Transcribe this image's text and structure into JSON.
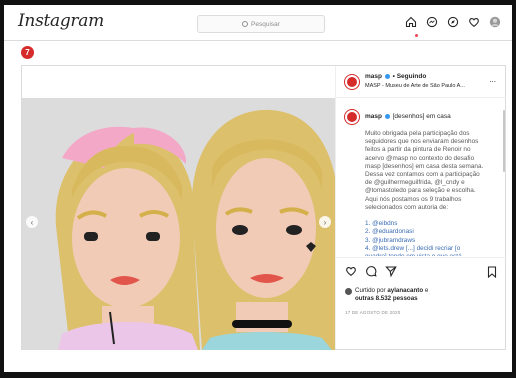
{
  "nav": {
    "logo": "Instagram",
    "search_placeholder": "Pesquisar",
    "icons": [
      "home-icon",
      "messenger-icon",
      "explore-icon",
      "heart-icon",
      "profile-avatar"
    ]
  },
  "notification_badge": "7",
  "post": {
    "account": "masp",
    "follow_status": "• Seguindo",
    "subtitle": "MASP - Museu de Arte de São Paulo A...",
    "more": "...",
    "caption_user": "masp",
    "caption_title": "[desenhos] em casa",
    "caption_lines": [
      {
        "text": "Muito obrigada pela participação dos",
        "link": false
      },
      {
        "text": "seguidores que nos enviaram desenhos",
        "link": false
      },
      {
        "text": "feitos a partir da pintura de Renoir no",
        "link": false
      },
      {
        "text": "acervo @masp no contexto do desafio",
        "link": false
      },
      {
        "text": "masp [desenhos] em casa desta semana.",
        "link": false
      },
      {
        "text": "Dessa vez contamos com a participação",
        "link": false
      },
      {
        "text": "de @guilhermeguilfrida, @l_cndy e",
        "link": false
      },
      {
        "text": "@tomastoledo para seleção e escolha.",
        "link": false
      },
      {
        "text": "Aqui nós postamos os 9 trabalhos",
        "link": false
      },
      {
        "text": "selecionados com autoria de:",
        "link": false
      },
      {
        "text": "",
        "link": false
      },
      {
        "text": "1. @eibdns",
        "link": true
      },
      {
        "text": "2. @eduardonasi",
        "link": true
      },
      {
        "text": "3. @jubramdraws",
        "link": true
      },
      {
        "text": "4. @lets.drew [...] decidi recriar [o",
        "link": true
      },
      {
        "text": "quadro] tendo em vista o que está",
        "link": true
      }
    ],
    "liked_by_prefix": "Curtido por ",
    "liked_by_user": "aylanacanto",
    "liked_by_suffix": " e",
    "liked_by_others": "outras 8.532 pessoas",
    "date": "17 DE AGOSTO DE 2020"
  },
  "colors": {
    "brand_red": "#d52b2b",
    "verified_blue": "#3897f0",
    "link_blue": "#3b6db3"
  }
}
